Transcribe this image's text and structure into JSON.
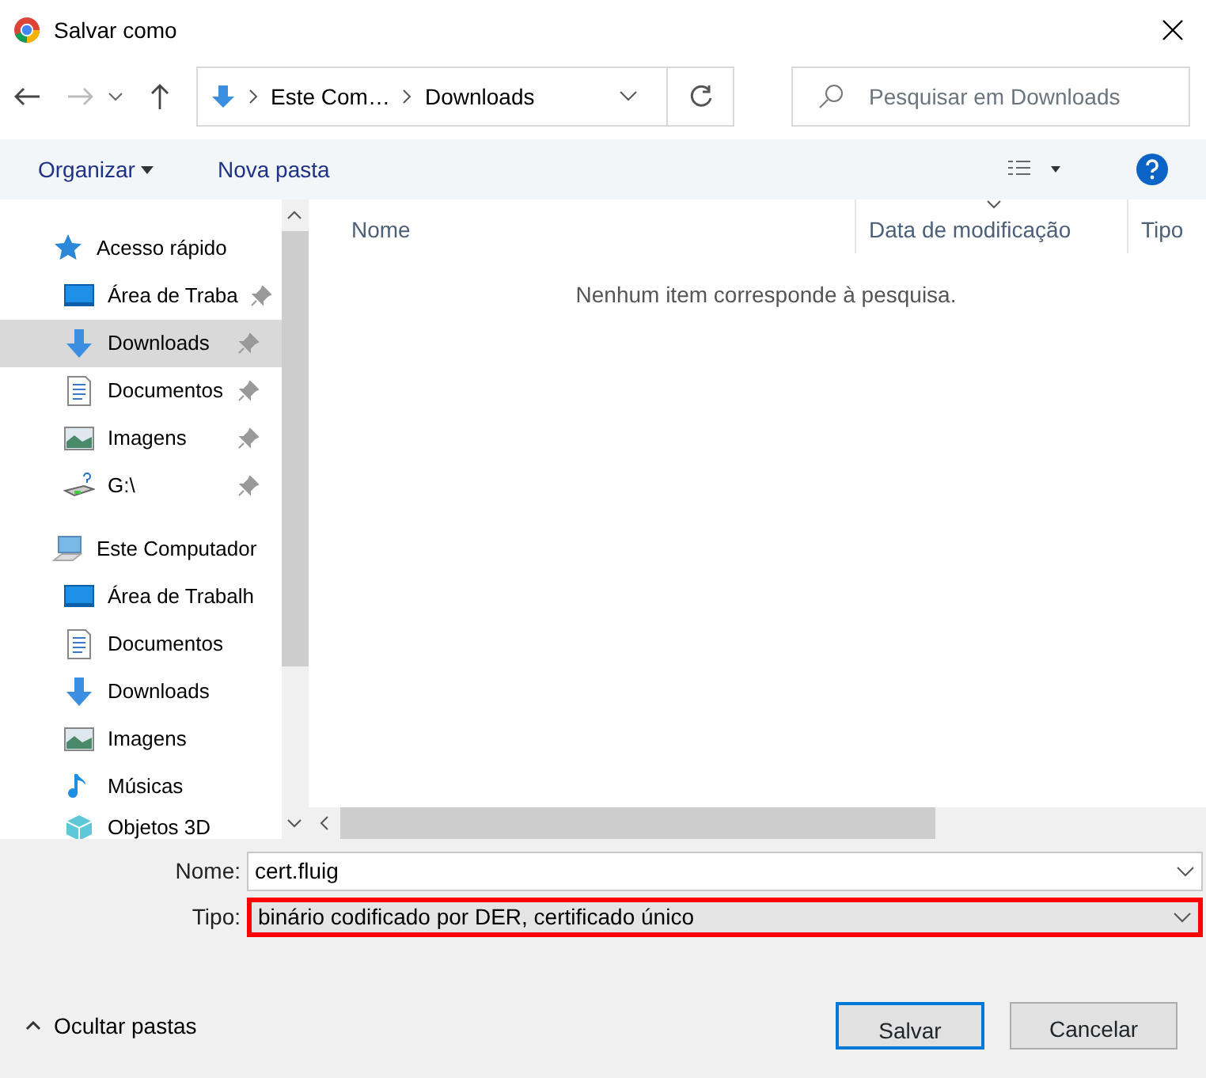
{
  "window": {
    "title": "Salvar como"
  },
  "address": {
    "segments": [
      "Este Com…",
      "Downloads"
    ]
  },
  "search": {
    "placeholder": "Pesquisar em Downloads"
  },
  "toolbar": {
    "organize": "Organizar",
    "new_folder": "Nova pasta"
  },
  "sidebar": {
    "items": [
      {
        "kind": "quickaccess",
        "label": "Acesso rápido",
        "pinned": false,
        "selected": false
      },
      {
        "kind": "desktop",
        "label": "Área de Traba",
        "pinned": true,
        "selected": false
      },
      {
        "kind": "download",
        "label": "Downloads",
        "pinned": true,
        "selected": true
      },
      {
        "kind": "document",
        "label": "Documentos",
        "pinned": true,
        "selected": false
      },
      {
        "kind": "image",
        "label": "Imagens",
        "pinned": true,
        "selected": false
      },
      {
        "kind": "drive",
        "label": "G:\\",
        "pinned": true,
        "selected": false
      },
      {
        "kind": "computer",
        "label": "Este Computador",
        "pinned": false,
        "selected": false
      },
      {
        "kind": "desktop",
        "label": "Área de Trabalh",
        "pinned": false,
        "selected": false
      },
      {
        "kind": "document",
        "label": "Documentos",
        "pinned": false,
        "selected": false
      },
      {
        "kind": "download",
        "label": "Downloads",
        "pinned": false,
        "selected": false
      },
      {
        "kind": "image",
        "label": "Imagens",
        "pinned": false,
        "selected": false
      },
      {
        "kind": "music",
        "label": "Músicas",
        "pinned": false,
        "selected": false
      },
      {
        "kind": "cube",
        "label": "Objetos 3D",
        "pinned": false,
        "selected": false
      }
    ]
  },
  "table": {
    "columns": [
      {
        "label": "Nome",
        "sorted": false
      },
      {
        "label": "Data de modificação",
        "sorted": true
      },
      {
        "label": "Tipo",
        "sorted": false
      }
    ],
    "empty_message": "Nenhum item corresponde à pesquisa."
  },
  "form": {
    "name_label": "Nome:",
    "name_value": "cert.fluig",
    "type_label": "Tipo:",
    "type_value": "binário codificado por DER, certificado único",
    "type_highlighted": true
  },
  "hide_folders": "Ocultar pastas",
  "buttons": [
    {
      "label": "Salvar",
      "default": true
    },
    {
      "label": "Cancelar",
      "default": false
    }
  ]
}
